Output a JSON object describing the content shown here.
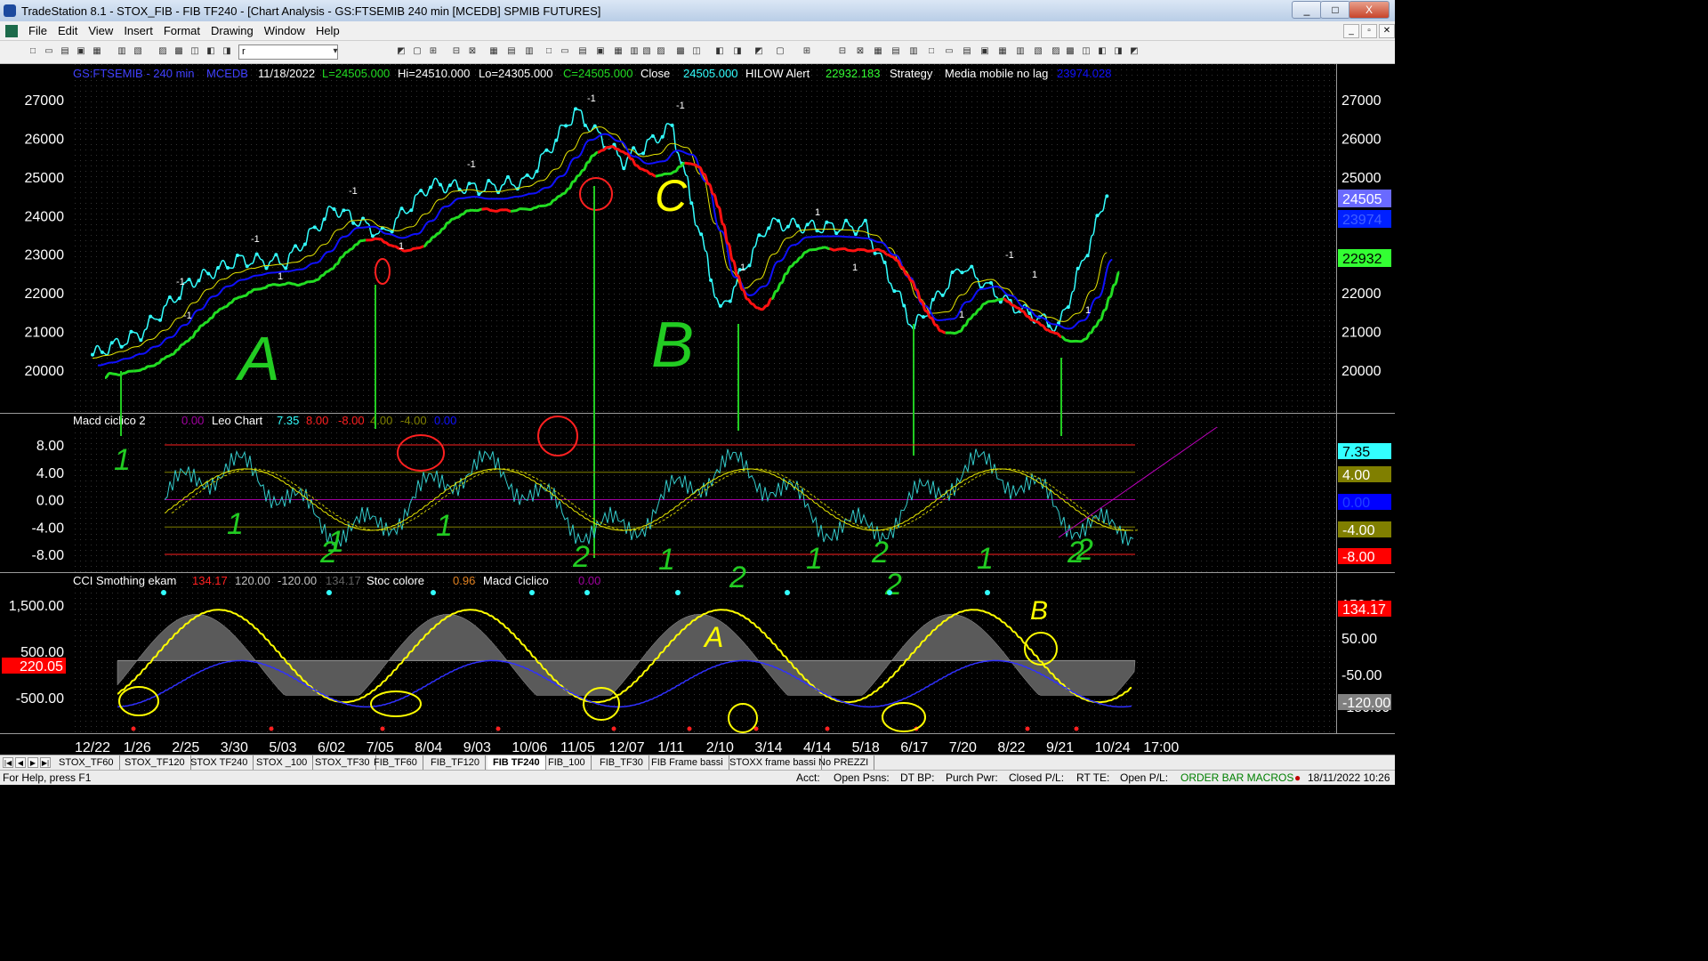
{
  "window": {
    "title": "TradeStation 8.1 - STOX_FIB - FIB TF240 - [Chart Analysis - GS:FTSEMIB  240 min  [MCEDB] SPMIB FUTURES]",
    "min": "_",
    "max": "□",
    "close": "X"
  },
  "menu": [
    "File",
    "Edit",
    "View",
    "Insert",
    "Format",
    "Drawing",
    "Window",
    "Help"
  ],
  "toolbar": {
    "symbol_value": "r"
  },
  "status_line": {
    "symbol": "GS:FTSEMIB - 240 min",
    "study": "MCEDB",
    "date": "11/18/2022",
    "last": "L=24505.000",
    "hi": "Hi=24510.000",
    "lo": "Lo=24305.000",
    "close_text": "C=24505.000",
    "close_label": "Close",
    "close_value": "24505.000",
    "hilow_label": "HILOW Alert",
    "hilow_value": "22932.183",
    "strategy_label": "Strategy",
    "media_label": "Media mobile no lag",
    "media_value": "23974.028"
  },
  "macd_pane": {
    "label": "Macd ciclico 2",
    "v1": "0.00",
    "leo_label": "Leo Chart",
    "v2": "7.35",
    "v3": "8.00",
    "v4": "-8.00",
    "v5": "4.00",
    "v6": "-4.00",
    "v7": "0.00"
  },
  "cci_pane": {
    "label": "CCI Smothing ekam",
    "v1": "134.17",
    "v2": "120.00",
    "v3": "-120.00",
    "v4": "134.17",
    "stoc_label": "Stoc colore",
    "stoc_value": "0.96",
    "macd_label": "Macd Ciclico",
    "macd_value": "0.00"
  },
  "price_axis": {
    "left_ticks": [
      "27000",
      "26000",
      "25000",
      "24000",
      "23000",
      "22000",
      "21000",
      "20000"
    ],
    "right_ticks": [
      "27000",
      "26000",
      "25000",
      "24000",
      "23000",
      "22000",
      "21000",
      "20000"
    ],
    "badges": [
      {
        "text": "24505",
        "bg": "#6a6aff",
        "fg": "#ffffff"
      },
      {
        "text": "23974",
        "bg": "#0020ff",
        "fg": "#4060ff"
      },
      {
        "text": "22932",
        "bg": "#33ff33",
        "fg": "#000000"
      }
    ]
  },
  "macd_axis": {
    "left_ticks": [
      "8.00",
      "4.00",
      "0.00",
      "-4.00",
      "-8.00"
    ],
    "badges": [
      {
        "text": "7.35",
        "bg": "#33ffff",
        "fg": "#000000"
      },
      {
        "text": "4.00",
        "bg": "#807f00",
        "fg": "#ffffff"
      },
      {
        "text": "0.00",
        "bg": "#0000ff",
        "fg": "#2040ff"
      },
      {
        "text": "-4.00",
        "bg": "#807f00",
        "fg": "#ffffff"
      },
      {
        "text": "-8.00",
        "bg": "#ff0000",
        "fg": "#ffffff"
      }
    ]
  },
  "cci_axis": {
    "left_ticks": [
      "1,500.00",
      "500.00",
      "-500.00"
    ],
    "left_badge": "220.05",
    "right_ticks": [
      "150.00",
      "50.00",
      "-50.00",
      "-150.00"
    ],
    "badges": [
      {
        "text": "134.17",
        "bg": "#ff0000",
        "fg": "#ffffff"
      },
      {
        "text": "-120.00",
        "bg": "#808080",
        "fg": "#ffffff"
      }
    ]
  },
  "date_axis": [
    "12/22",
    "1/26",
    "2/25",
    "3/30",
    "5/03",
    "6/02",
    "7/05",
    "8/04",
    "9/03",
    "10/06",
    "11/05",
    "12/07",
    "1/11",
    "2/10",
    "3/14",
    "4/14",
    "5/18",
    "6/17",
    "7/20",
    "8/22",
    "9/21",
    "10/24",
    "17:00"
  ],
  "annotations": {
    "A": "A",
    "B": "B",
    "C": "C",
    "A2": "A",
    "B2": "B",
    "marks": [
      "1",
      "2",
      "1",
      "2",
      "1",
      "2",
      "1",
      "2",
      "1",
      "2",
      "1",
      "2",
      "1",
      "2"
    ],
    "bar_marks": [
      "-1",
      "-1",
      "-1",
      "-1",
      "-1",
      "-1",
      "-1",
      "-1",
      "1",
      "1",
      "1",
      "1",
      "1",
      "1",
      "1",
      "1"
    ]
  },
  "sheet_tabs": [
    "STOX_TF60",
    "STOX_TF120",
    "STOX TF240",
    "STOX _100",
    "STOX_TF30",
    "FIB_TF60",
    "FIB_TF120",
    "FIB TF240",
    "FIB_100",
    "FIB_TF30",
    "FIB Frame bassi",
    "STOXX frame bassi",
    "No PREZZI"
  ],
  "active_tab": "FIB TF240",
  "status_bar": {
    "help": "For Help, press F1",
    "acct": "Acct:",
    "open_psns": "Open Psns:",
    "dt_bp": "DT BP:",
    "purch_pwr": "Purch Pwr:",
    "closed_pl": "Closed P/L:",
    "rt_te": "RT TE:",
    "open_pl": "Open P/L:",
    "macros": "ORDER BAR  MACROS",
    "datetime": "18/11/2022 10:26"
  },
  "colors": {
    "up_line": "#22dd22",
    "down_line": "#ff1111",
    "price": "#33ffff",
    "ma_yellow": "#e6e600",
    "ma_blue": "#1010ff",
    "pen_green": "#22cc22",
    "pen_yellow": "#ffff00"
  },
  "chart_data": {
    "type": "line",
    "title": "GS:FTSEMIB - 240 min",
    "x": [
      "12/22",
      "1/26",
      "2/25",
      "3/30",
      "5/03",
      "6/02",
      "7/05",
      "8/04",
      "9/03",
      "10/06",
      "11/05",
      "12/07",
      "1/11",
      "2/10",
      "3/14",
      "4/14",
      "5/18",
      "6/17",
      "7/20",
      "8/22",
      "9/21",
      "10/24"
    ],
    "ylim": [
      19500,
      27300
    ],
    "series": [
      {
        "name": "Close",
        "values": [
          20400,
          20950,
          22250,
          22850,
          22800,
          24200,
          23500,
          24800,
          24700,
          24900,
          26700,
          25400,
          26300,
          21500,
          23800,
          23700,
          23700,
          21100,
          22700,
          21700,
          21100,
          24505
        ]
      }
    ]
  }
}
